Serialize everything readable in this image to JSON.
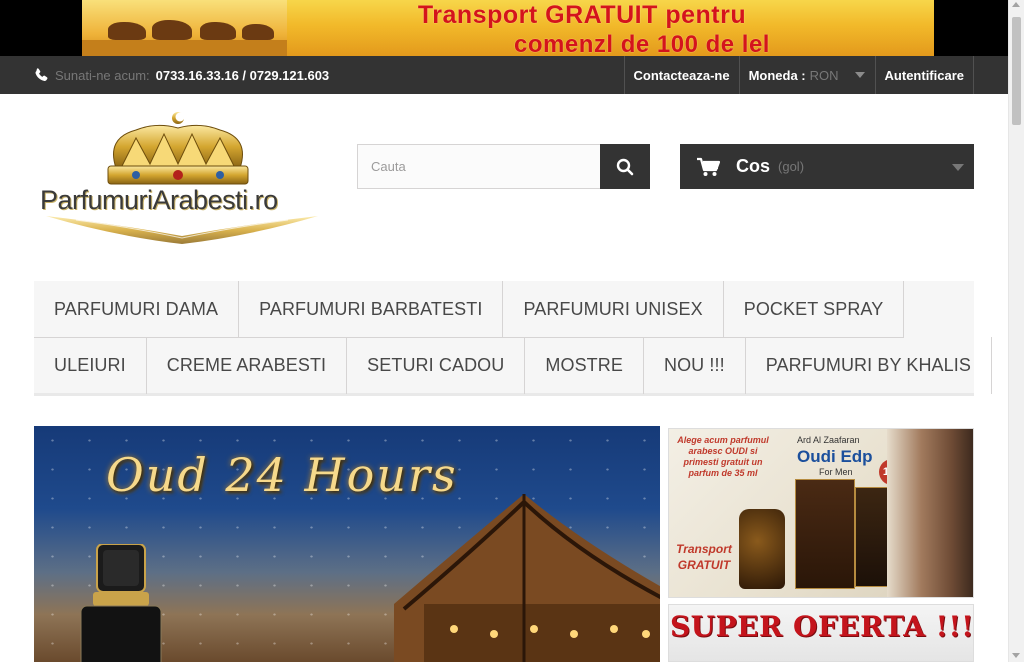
{
  "promo": {
    "line1": "Transport GRATUIT pentru",
    "line2": "comenzl de 100 de lel"
  },
  "topnav": {
    "phone_label": "Sunati-ne acum:",
    "phone_numbers": "0733.16.33.16 / 0729.121.603",
    "contact": "Contacteaza-ne",
    "currency_label": "Moneda :",
    "currency_value": "RON",
    "login": "Autentificare"
  },
  "header": {
    "logo_text": "ParfumuriArabesti.ro",
    "search_placeholder": "Cauta",
    "cart_label": "Cos",
    "cart_status": "(gol)"
  },
  "menu": {
    "row1": [
      "PARFUMURI DAMA",
      "PARFUMURI BARBATESTI",
      "PARFUMURI UNISEX",
      "POCKET SPRAY"
    ],
    "row2": [
      "ULEIURI",
      "CREME ARABESTI",
      "SETURI CADOU",
      "MOSTRE",
      "NOU !!!",
      "PARFUMURI BY KHALIS"
    ]
  },
  "hero": {
    "title": "Oud 24 Hours"
  },
  "side_banner_1": {
    "offer_text": "Alege acum parfumul arabesc OUDI si primesti gratuit un parfum de 35 ml",
    "brand": "Ard Al Zaafaran",
    "title": "Oudi Edp",
    "subtitle": "For Men",
    "badge": "100",
    "transport": "Transport GRATUIT"
  },
  "side_banner_2": {
    "title": "SUPER OFERTA !!!"
  },
  "colors": {
    "dark_bar": "#333333",
    "promo_red": "#d4141c",
    "menu_bg": "#f6f6f6"
  }
}
